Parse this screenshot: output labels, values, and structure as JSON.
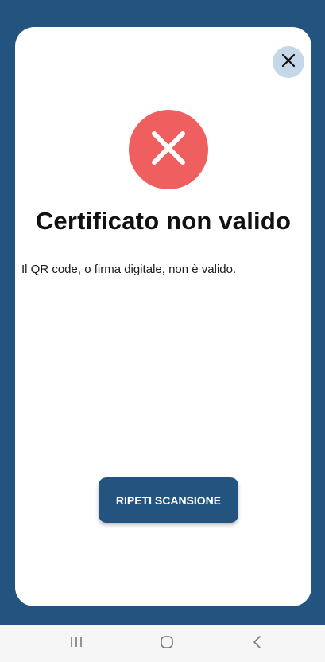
{
  "dialog": {
    "title": "Certificato non valido",
    "message": "Il QR code, o firma digitale, non è valido.",
    "retry_label": "RIPETI SCANSIONE",
    "close_icon": "close-icon",
    "status_icon": "error-x-icon"
  },
  "system_nav": {
    "recents_icon": "recents-icon",
    "home_icon": "home-icon",
    "back_icon": "back-icon"
  },
  "colors": {
    "brand_blue": "#235480",
    "error_red": "#ef5f60",
    "close_bg": "#c7d7ea",
    "nav_bg": "#f6f6f6"
  }
}
